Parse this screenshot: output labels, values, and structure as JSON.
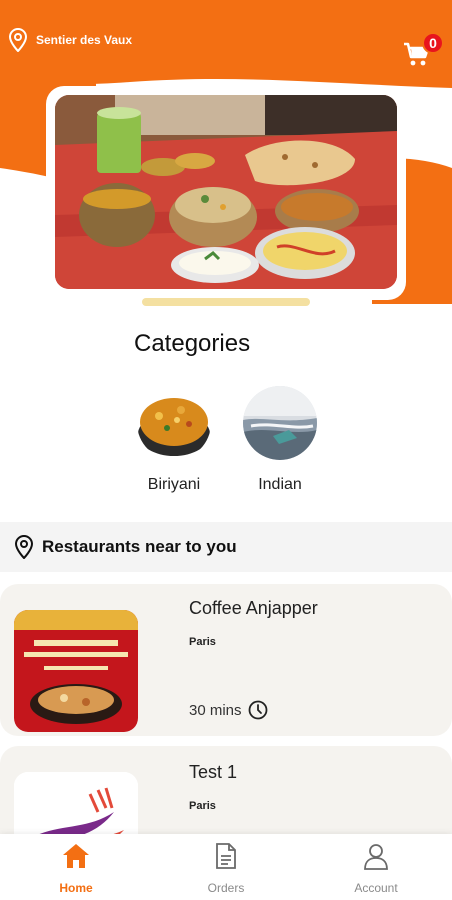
{
  "header": {
    "location": "Sentier des Vaux",
    "cart_count": "0"
  },
  "categories": {
    "title": "Categories",
    "items": [
      {
        "label": "Biriyani"
      },
      {
        "label": "Indian"
      }
    ]
  },
  "restaurants": {
    "section_title": "Restaurants near to you",
    "items": [
      {
        "name": "Coffee Anjapper",
        "city": "Paris",
        "time": "30 mins"
      },
      {
        "name": "Test 1",
        "city": "Paris"
      }
    ]
  },
  "nav": {
    "items": [
      {
        "label": "Home",
        "active": true
      },
      {
        "label": "Orders",
        "active": false
      },
      {
        "label": "Account",
        "active": false
      }
    ]
  },
  "colors": {
    "brand": "#f36f13",
    "badge": "#e8141d"
  }
}
